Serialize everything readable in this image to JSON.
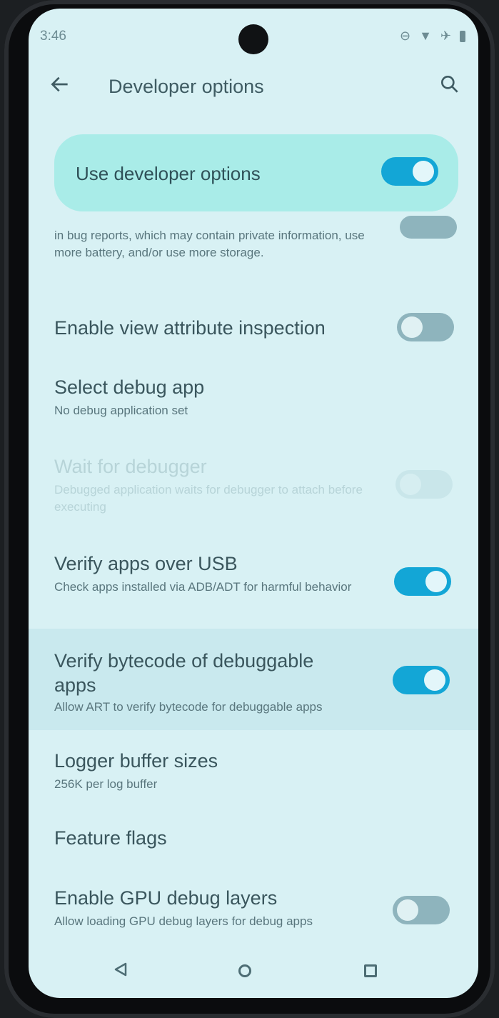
{
  "status_bar": {
    "time": "3:46"
  },
  "app_bar": {
    "title": "Developer options"
  },
  "master": {
    "label": "Use developer options",
    "state": "on"
  },
  "settings": [
    {
      "id": "partial",
      "subtitle": "in bug reports, which may contain private information, use more battery, and/or use more storage.",
      "state": "off"
    },
    {
      "id": "view-attr",
      "title": "Enable view attribute inspection",
      "state": "off"
    },
    {
      "id": "debug-app",
      "title": "Select debug app",
      "subtitle": "No debug application set"
    },
    {
      "id": "wait-debugger",
      "title": "Wait for debugger",
      "subtitle": "Debugged application waits for debugger to attach before executing",
      "state": "disabled"
    },
    {
      "id": "verify-usb",
      "title": "Verify apps over USB",
      "subtitle": "Check apps installed via ADB/ADT for harmful behavior",
      "state": "on"
    },
    {
      "id": "verify-bytecode",
      "title": "Verify bytecode of debuggable apps",
      "subtitle": "Allow ART to verify bytecode for debuggable apps",
      "state": "on"
    },
    {
      "id": "logger",
      "title": "Logger buffer sizes",
      "subtitle": "256K per log buffer"
    },
    {
      "id": "feature-flags",
      "title": "Feature flags"
    },
    {
      "id": "gpu-debug",
      "title": "Enable GPU debug layers",
      "subtitle": "Allow loading GPU debug layers for debug apps",
      "state": "off"
    }
  ],
  "colors": {
    "accent": "#13a6d6",
    "background": "#d8f1f4",
    "master_card": "#a9ece8"
  }
}
